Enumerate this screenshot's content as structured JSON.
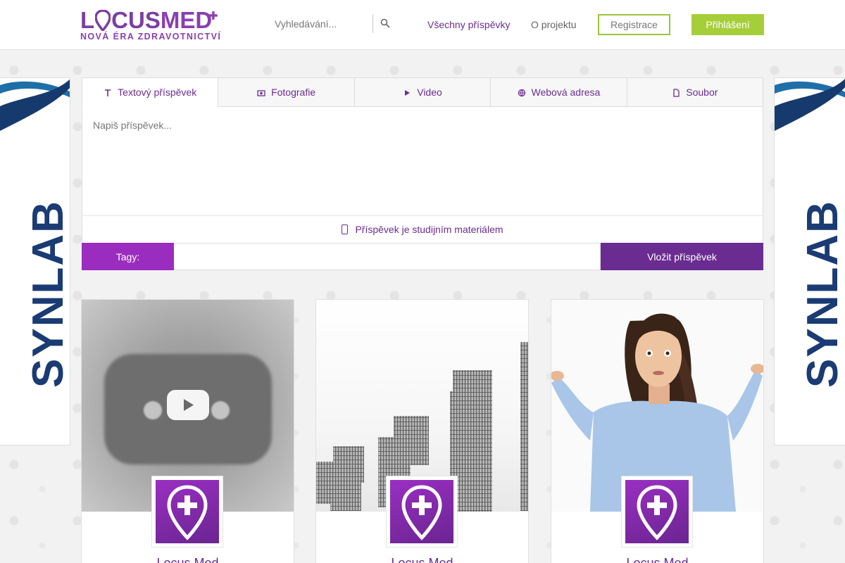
{
  "header": {
    "logo": {
      "main_left": "L",
      "main_mid": "CUS",
      "main_right": "MED",
      "tagline": "NOVÁ ÉRA ZDRAVOTNICTVÍ"
    },
    "search": {
      "placeholder": "Vyhledávání..."
    },
    "nav": {
      "all_posts": "Všechny příspěvky",
      "about": "O projektu"
    },
    "register_label": "Registrace",
    "login_label": "Přihlášení"
  },
  "side_ads": {
    "brand": "SYNLAB"
  },
  "composer": {
    "tabs": [
      {
        "label": "Textový příspěvek",
        "icon": "text-icon",
        "active": true
      },
      {
        "label": "Fotografie",
        "icon": "photo-icon",
        "active": false
      },
      {
        "label": "Video",
        "icon": "video-icon",
        "active": false
      },
      {
        "label": "Webová adresa",
        "icon": "link-icon",
        "active": false
      },
      {
        "label": "Soubor",
        "icon": "file-icon",
        "active": false
      }
    ],
    "textarea_placeholder": "Napiš příspěvek...",
    "study_material_label": "Příspěvek je studijním materiálem",
    "tags_label": "Tagy:",
    "submit_label": "Vložit příspěvek"
  },
  "cards": [
    {
      "author": "Locus Med",
      "image": "youtube-placeholder"
    },
    {
      "author": "Locus Med",
      "image": "coin-stacks"
    },
    {
      "author": "Locus Med",
      "image": "shrugging-woman"
    }
  ],
  "colors": {
    "primary": "#6a2c91",
    "magenta": "#9b2cc0",
    "green": "#a6ce39",
    "synlab_blue": "#1a3b73"
  }
}
